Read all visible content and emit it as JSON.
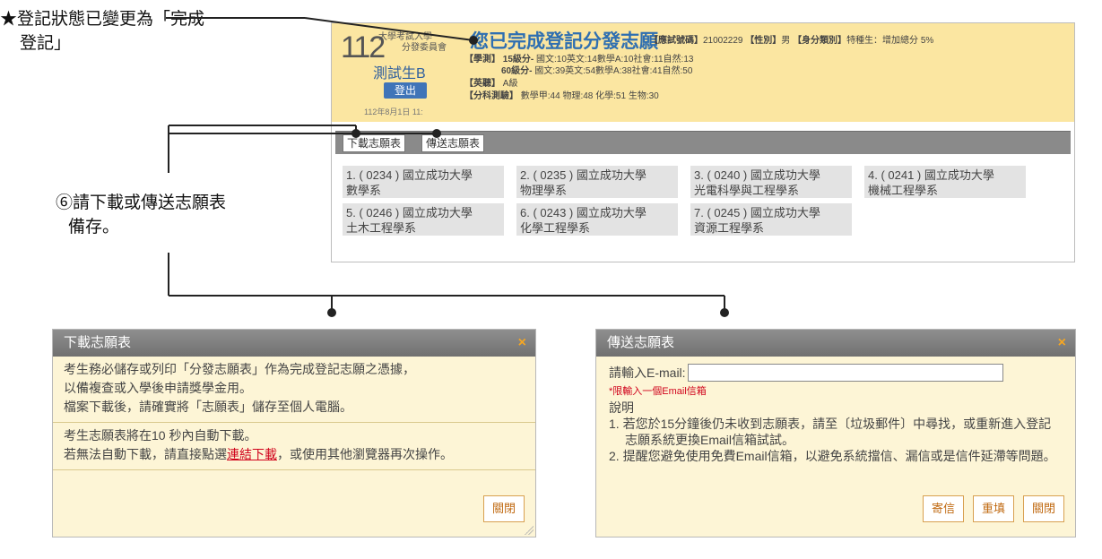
{
  "annotations": {
    "status_line1": "★登記狀態已變更為「完成",
    "status_line2": "登記」",
    "download_line1": "⑥請下載或傳送志願表",
    "download_line2": "備存。"
  },
  "header": {
    "logo_number": "112",
    "logo_text1": "大學考試入學",
    "logo_text2": "分發委員會",
    "student_name": "測試生B",
    "logout_label": "登出",
    "login_time": "112年8月1日 11:",
    "page_title": "您已完成登記分發志願",
    "exam_no_label": "【應試號碼】",
    "exam_no": "21002229",
    "gender_label": "【性別】",
    "gender": "男",
    "identity_label": "【身分類別】",
    "identity": "特種生：增加總分 5%",
    "xc_label": "【學測】",
    "xc15": "15級分-",
    "xc15_scores": "國文:10英文:14數學A:10社會:11自然:13",
    "xc60": "60級分-",
    "xc60_scores": "國文:39英文:54數學A:38社會:41自然:50",
    "eng_label": "【英聽】",
    "eng_level": "A級",
    "fk_label": "【分科測驗】",
    "fk_scores": "數學甲:44 物理:48 化學:51 生物:30"
  },
  "toolbar": {
    "download_label": "下載志願表",
    "send_label": "傳送志願表"
  },
  "choices": [
    {
      "line1": "1. ( 0234 ) 國立成功大學",
      "line2": "數學系"
    },
    {
      "line1": "2. ( 0235 ) 國立成功大學",
      "line2": "物理學系"
    },
    {
      "line1": "3. ( 0240 ) 國立成功大學",
      "line2": "光電科學與工程學系"
    },
    {
      "line1": "4. ( 0241 ) 國立成功大學",
      "line2": "機械工程學系"
    },
    {
      "line1": "5. ( 0246 ) 國立成功大學",
      "line2": "土木工程學系"
    },
    {
      "line1": "6. ( 0243 ) 國立成功大學",
      "line2": "化學工程學系"
    },
    {
      "line1": "7. ( 0245 ) 國立成功大學",
      "line2": "資源工程學系"
    }
  ],
  "download_dialog": {
    "title": "下載志願表",
    "close_icon": "×",
    "p1_line1": "考生務必儲存或列印「分發志願表」作為完成登記志願之憑據，",
    "p1_line2": "以備複查或入學後申請獎學金用。",
    "p1_line3": "檔案下載後，請確實將「志願表」儲存至個人電腦。",
    "p2_line1": "考生志願表將在10 秒內自動下載。",
    "p2_line2_a": "若無法自動下載，請直接點選",
    "p2_link": "連結下載",
    "p2_line2_b": "，或使用其他瀏覽器再次操作。",
    "close_label": "關閉"
  },
  "send_dialog": {
    "title": "傳送志願表",
    "close_icon": "×",
    "email_label": "請輸入E-mail:",
    "email_value": "",
    "limit_note": "*限輸入一個Email信箱",
    "desc_label": "說明",
    "note1": "1.  若您於15分鐘後仍未收到志願表，請至〔垃圾郵件〕中尋找，或重新進入登記志願系統更換Email信箱試試。",
    "note2": "2.  提醒您避免使用免費Email信箱，以避免系統擋信、漏信或是信件延滯等問題。",
    "send_label": "寄信",
    "reset_label": "重填",
    "close_label": "關閉"
  }
}
